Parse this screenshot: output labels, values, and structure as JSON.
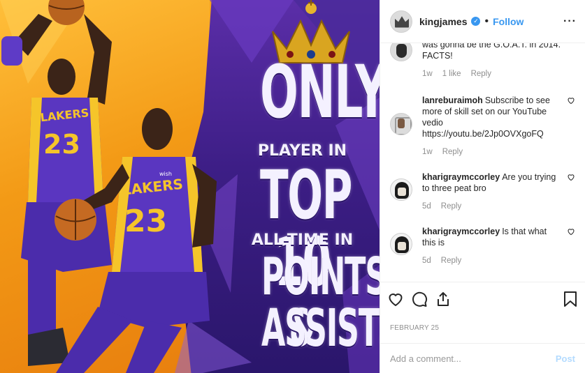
{
  "post_image": {
    "headline_line1": "ONLY",
    "headline_line2": "PLAYER IN",
    "headline_line3": "TOP 10",
    "headline_line4": "ALL-TIME IN",
    "headline_line5": "POINTS &",
    "headline_line6": "ASSISTS",
    "jersey_text": "LAKERS",
    "jersey_number": "23",
    "sponsor_patch": "wish",
    "colors": {
      "orange": "#f39a16",
      "purple": "#3d1e86",
      "gold": "#f5c52a"
    }
  },
  "header": {
    "username": "kingjames",
    "verified_icon": "verified-badge-icon",
    "separator": "•",
    "follow_label": "Follow",
    "more_icon": "more-options-icon",
    "more_label": "···"
  },
  "comments": [
    {
      "username": "",
      "text": "was gonna be the G.O.A.T. in 2014. FACTS!",
      "time": "1w",
      "likes": "1 like",
      "reply_label": "Reply",
      "has_heart": false
    },
    {
      "username": "lanreburaimoh",
      "text": "Subscribe to see more of skill set on our YouTube vedio https://youtu.be/2Jp0OVXgoFQ",
      "time": "1w",
      "likes": "",
      "reply_label": "Reply",
      "has_heart": true
    },
    {
      "username": "kharigraymccorley",
      "text": "Are you trying to three peat bro",
      "time": "5d",
      "likes": "",
      "reply_label": "Reply",
      "has_heart": true
    },
    {
      "username": "kharigraymccorley",
      "text": "Is that what this is",
      "time": "5d",
      "likes": "",
      "reply_label": "Reply",
      "has_heart": true
    }
  ],
  "actions": {
    "like_icon": "heart-icon",
    "comment_icon": "comment-icon",
    "share_icon": "share-icon",
    "save_icon": "bookmark-icon"
  },
  "date": "FEBRUARY 25",
  "add_comment": {
    "placeholder": "Add a comment...",
    "post_label": "Post"
  },
  "accent_color": "#3897f0"
}
